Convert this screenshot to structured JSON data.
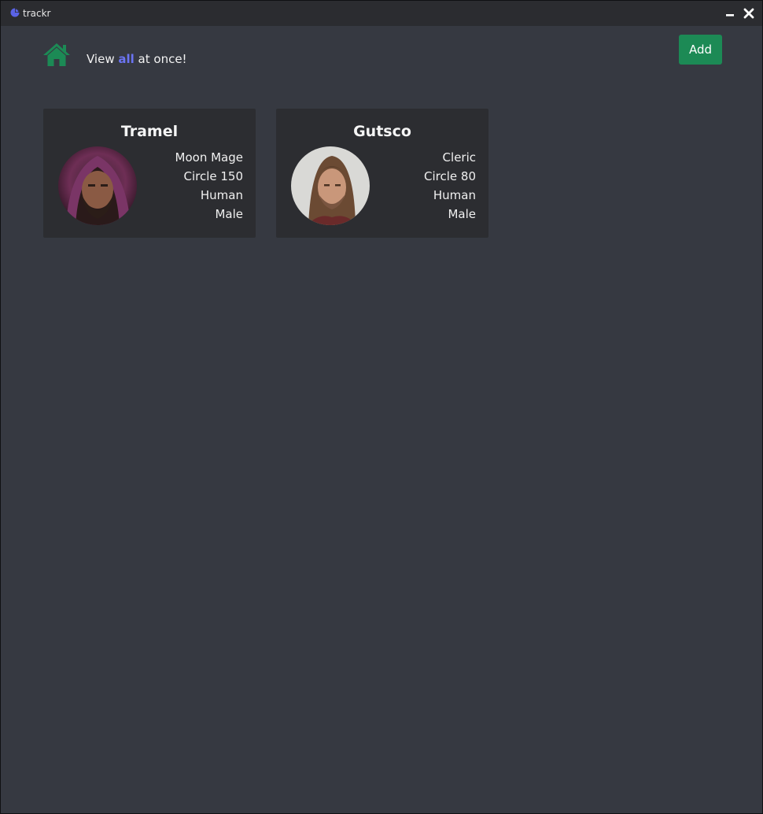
{
  "window": {
    "title": "trackr"
  },
  "header": {
    "tagline_prefix": "View ",
    "tagline_accent": "all",
    "tagline_suffix": " at once!",
    "add_label": "Add"
  },
  "characters": [
    {
      "name": "Tramel",
      "guild": "Moon Mage",
      "circle": "Circle 150",
      "race": "Human",
      "gender": "Male"
    },
    {
      "name": "Gutsco",
      "guild": "Cleric",
      "circle": "Circle 80",
      "race": "Human",
      "gender": "Male"
    }
  ],
  "colors": {
    "background": "#363941",
    "titlebar": "#2b2c30",
    "card": "#2c2d31",
    "accent": "#6b74f2",
    "brand_green": "#1c8a55"
  },
  "icons": {
    "app": "pie-chart-icon",
    "home": "home-icon",
    "minimize": "minimize-icon",
    "close": "close-icon"
  }
}
